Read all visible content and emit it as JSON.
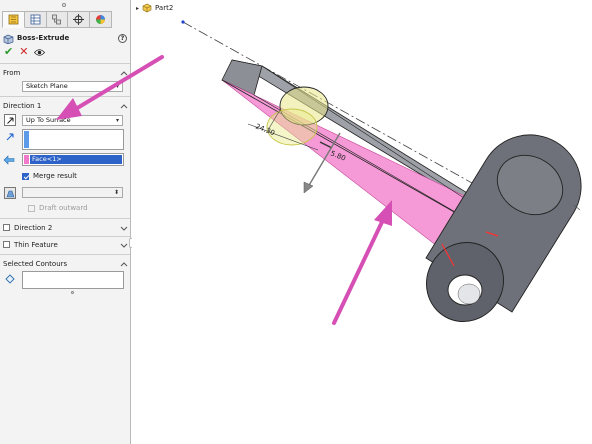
{
  "panel": {
    "feature_title": "Boss-Extrude",
    "help_label": "?",
    "ok_symbol": "✔",
    "cancel_symbol": "✕",
    "sections": {
      "from": {
        "title": "From",
        "start_condition": "Sketch Plane"
      },
      "direction1": {
        "title": "Direction 1",
        "end_condition": "Up To Surface",
        "face_selection": "Face<1>",
        "merge_result_label": "Merge result",
        "merge_result_checked": true,
        "draft_outward_label": "Draft outward"
      },
      "direction2": {
        "title": "Direction 2"
      },
      "thin_feature": {
        "title": "Thin Feature"
      },
      "selected_contours": {
        "title": "Selected Contours"
      }
    }
  },
  "tree": {
    "root_label": "Part2"
  },
  "model": {
    "dimension_a": "24.30",
    "dimension_b": "5.80"
  },
  "colors": {
    "annotation_arrow": "#d64fb5",
    "preview_face": "#f59ad6",
    "body_gray": "#6e7179",
    "selection_blue": "#2d63c8",
    "preview_yellow": "#e9e88a"
  }
}
